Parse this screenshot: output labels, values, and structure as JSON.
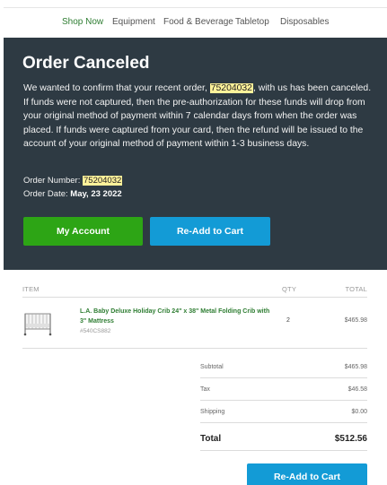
{
  "nav": {
    "items": [
      {
        "label": "Shop Now",
        "active": true
      },
      {
        "label": "Equipment",
        "active": false
      },
      {
        "label": "Food & Beverage",
        "active": false
      },
      {
        "label": "Tabletop",
        "active": false
      },
      {
        "label": "Disposables",
        "active": false
      }
    ]
  },
  "hero": {
    "title": "Order Canceled",
    "message_before": "We wanted to confirm that your recent order, ",
    "order_number": "75204032",
    "message_after": ", with us has been canceled. If funds were not captured, then the pre-authorization for these funds will drop from your original method of payment within 7 calendar days from when the order was placed. If funds were captured from your card, then the refund will be issued to the account of your original method of payment within 1-3 business days.",
    "order_number_label": "Order Number: ",
    "order_date_label": "Order Date: ",
    "order_date": "May, 23 2022",
    "my_account_label": "My Account",
    "readd_label": "Re-Add to Cart"
  },
  "table": {
    "headers": {
      "item": "ITEM",
      "qty": "QTY",
      "total": "TOTAL"
    },
    "items": [
      {
        "image_icon": "crib-icon",
        "name": "L.A. Baby Deluxe Holiday Crib 24\" x 38\" Metal Folding Crib with 3\" Mattress",
        "sku": "#540CS882",
        "qty": "2",
        "price": "$465.98"
      }
    ]
  },
  "totals": {
    "subtotal_label": "Subtotal",
    "subtotal": "$465.98",
    "tax_label": "Tax",
    "tax": "$46.58",
    "shipping_label": "Shipping",
    "shipping": "$0.00",
    "total_label": "Total",
    "total": "$512.56"
  },
  "footer": {
    "readd_label": "Re-Add to Cart"
  },
  "colors": {
    "hero_bg": "#2e3a43",
    "green": "#2da515",
    "blue": "#139bd6",
    "highlight": "#fff29a",
    "nav_active": "#2e7d32"
  }
}
